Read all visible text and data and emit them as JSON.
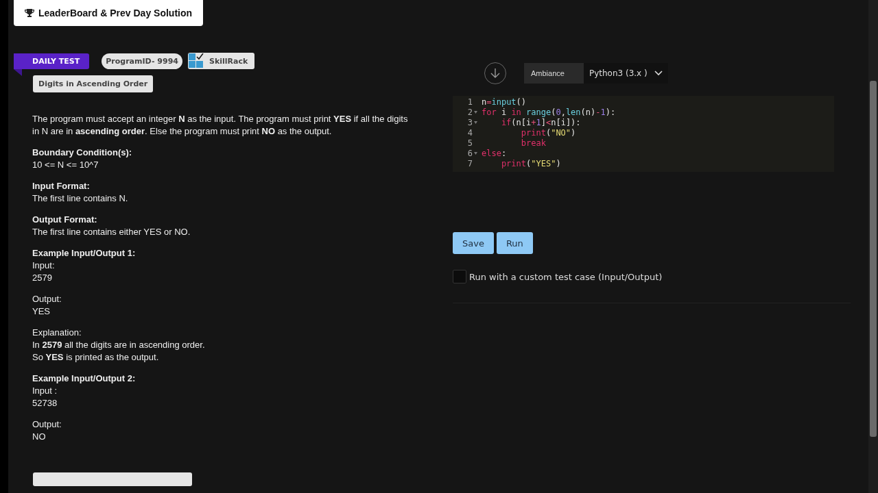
{
  "leaderboard_button": {
    "label": "LeaderBoard & Prev Day Solution"
  },
  "ribbon": {
    "label": "DAILY TEST"
  },
  "program_id": {
    "label": "ProgramID- 9994"
  },
  "brand": {
    "label": "SkillRack"
  },
  "problem_title": {
    "label": "Digits in Ascending Order"
  },
  "description": [
    {
      "lines": [
        "The program must accept an integer **N** as the input. The program must print **YES** if all the digits in N are in **ascending order**. Else the program must print **NO** as the output."
      ]
    },
    {
      "heading": "Boundary Condition(s):",
      "lines": [
        "10 <= N <= 10^7"
      ]
    },
    {
      "heading": "Input Format:",
      "lines": [
        "The first line contains N."
      ]
    },
    {
      "heading": "Output Format:",
      "lines": [
        "The first line contains either YES or NO."
      ]
    },
    {
      "heading": "Example Input/Output 1:",
      "lines": [
        "Input:",
        "2579"
      ]
    },
    {
      "lines": [
        "Output:",
        "YES"
      ]
    },
    {
      "lines": [
        "Explanation:",
        "In **2579** all the digits are in ascending order.",
        "So **YES** is printed as the output."
      ]
    },
    {
      "heading": "Example Input/Output 2:",
      "lines": [
        "Input :",
        "52738"
      ]
    },
    {
      "lines": [
        "Output:",
        "NO"
      ]
    }
  ],
  "editor": {
    "theme": "Ambiance",
    "language": "Python3 (3.x )",
    "lines": [
      {
        "number": "1",
        "fold": false,
        "tokens": [
          {
            "kind": "plain",
            "text": "n"
          },
          {
            "kind": "op",
            "text": "="
          },
          {
            "kind": "func",
            "text": "input"
          },
          {
            "kind": "plain",
            "text": "()"
          }
        ]
      },
      {
        "number": "2",
        "fold": true,
        "tokens": [
          {
            "kind": "kw",
            "text": "for"
          },
          {
            "kind": "plain",
            "text": " i "
          },
          {
            "kind": "kw",
            "text": "in"
          },
          {
            "kind": "func",
            "text": " range"
          },
          {
            "kind": "plain",
            "text": "("
          },
          {
            "kind": "num",
            "text": "0"
          },
          {
            "kind": "plain",
            "text": ","
          },
          {
            "kind": "func",
            "text": "len"
          },
          {
            "kind": "plain",
            "text": "(n)"
          },
          {
            "kind": "op",
            "text": "-"
          },
          {
            "kind": "num",
            "text": "1"
          },
          {
            "kind": "plain",
            "text": "):"
          }
        ]
      },
      {
        "number": "3",
        "fold": true,
        "tokens": [
          {
            "kind": "kw",
            "text": "    if"
          },
          {
            "kind": "plain",
            "text": "(n[i"
          },
          {
            "kind": "op",
            "text": "+"
          },
          {
            "kind": "num",
            "text": "1"
          },
          {
            "kind": "plain",
            "text": "]"
          },
          {
            "kind": "op",
            "text": "<"
          },
          {
            "kind": "plain",
            "text": "n[i]):"
          }
        ]
      },
      {
        "number": "4",
        "fold": false,
        "tokens": [
          {
            "kind": "kw",
            "text": "        print"
          },
          {
            "kind": "plain",
            "text": "("
          },
          {
            "kind": "str",
            "text": "\"NO\""
          },
          {
            "kind": "plain",
            "text": ")"
          }
        ]
      },
      {
        "number": "5",
        "fold": false,
        "tokens": [
          {
            "kind": "kw",
            "text": "        break"
          }
        ]
      },
      {
        "number": "6",
        "fold": true,
        "tokens": [
          {
            "kind": "kw",
            "text": "else"
          },
          {
            "kind": "plain",
            "text": ":"
          }
        ]
      },
      {
        "number": "7",
        "fold": false,
        "tokens": [
          {
            "kind": "kw",
            "text": "    print"
          },
          {
            "kind": "plain",
            "text": "("
          },
          {
            "kind": "str",
            "text": "\"YES\""
          },
          {
            "kind": "plain",
            "text": ")"
          }
        ]
      }
    ]
  },
  "buttons": [
    "Save",
    "Run"
  ],
  "custom_test": {
    "label": "Run with a custom test case (Input/Output)",
    "checked": false
  }
}
